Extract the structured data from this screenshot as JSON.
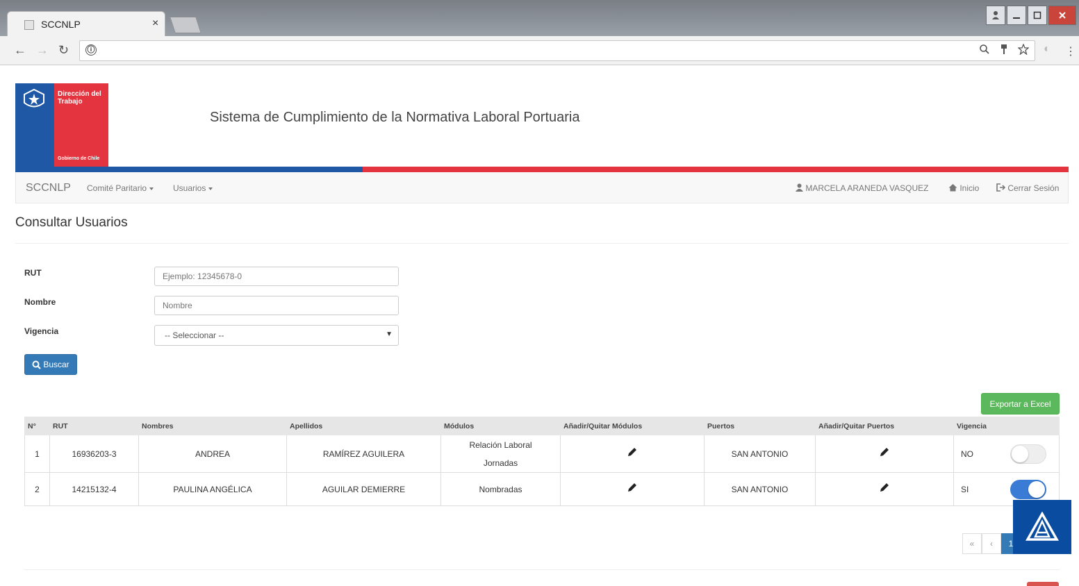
{
  "browser": {
    "tab_title": "SCCNLP",
    "tab_close": "×",
    "info_icon": "ⓘ"
  },
  "header": {
    "logo_title": "Dirección del Trabajo",
    "logo_subtitle": "Gobierno de Chile",
    "site_title": "Sistema de Cumplimiento de la Normativa Laboral Portuaria",
    "colors": {
      "blue": "#1f58a5",
      "red": "#e3343f"
    }
  },
  "navbar": {
    "brand": "SCCNLP",
    "menu": [
      {
        "label": "Comité Paritario"
      },
      {
        "label": "Usuarios"
      }
    ],
    "user_name": "MARCELA ARANEDA VASQUEZ",
    "home_label": "Inicio",
    "logout_label": "Cerrar Sesión"
  },
  "page": {
    "title": "Consultar Usuarios"
  },
  "form": {
    "rut_label": "RUT",
    "rut_placeholder": "Ejemplo: 12345678-0",
    "nombre_label": "Nombre",
    "nombre_placeholder": "Nombre",
    "vigencia_label": "Vigencia",
    "vigencia_selected": "-- Seleccionar --",
    "search_button": "Buscar"
  },
  "export_button": "Exportar a Excel",
  "table": {
    "headers": [
      "N°",
      "RUT",
      "Nombres",
      "Apellidos",
      "Módulos",
      "Añadir/Quitar Módulos",
      "Puertos",
      "Añadir/Quitar Puertos",
      "Vigencia"
    ],
    "rows": [
      {
        "n": "1",
        "rut": "16936203-3",
        "nombres": "ANDREA",
        "apellidos": "RAMÍREZ AGUILERA",
        "modulos": [
          "Relación Laboral",
          "Jornadas"
        ],
        "puertos": "SAN ANTONIO",
        "vigencia": "NO",
        "active": false
      },
      {
        "n": "2",
        "rut": "14215132-4",
        "nombres": "PAULINA ANGÉLICA",
        "apellidos": "AGUILAR DEMIERRE",
        "modulos": [
          "Nombradas"
        ],
        "puertos": "SAN ANTONIO",
        "vigencia": "SI",
        "active": true
      }
    ]
  },
  "pagination": {
    "first": "«",
    "prev": "‹",
    "current": "1"
  }
}
